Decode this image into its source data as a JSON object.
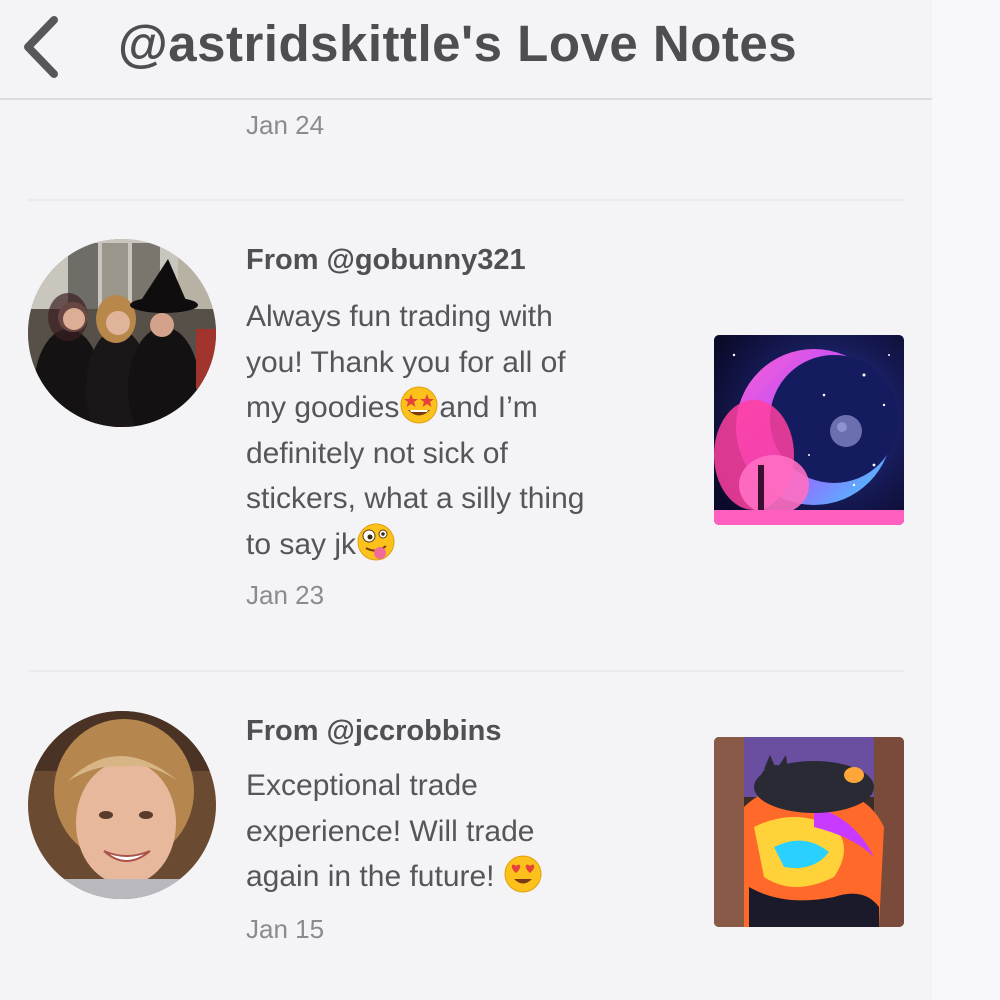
{
  "header": {
    "back_icon": "chevron-left-icon",
    "title": "@astridskittle's Love Notes"
  },
  "notes": [
    {
      "date": "Jan 24"
    },
    {
      "sender": "From @gobunny321",
      "message_lines": [
        "Always fun trading with",
        "you! Thank you for all of",
        "my goodies",
        "and I’m",
        "definitely not sick of",
        "stickers, what a silly thing",
        "to say jk"
      ],
      "emojis": [
        "star-struck-emoji",
        "zany-face-emoji"
      ],
      "date": "Jan 23",
      "photo": "moon-artwork-photo",
      "avatar": "three-women-costume-avatar"
    },
    {
      "sender": "From @jccrobbins",
      "message_lines": [
        "Exceptional trade",
        "experience! Will trade",
        "again in the future!"
      ],
      "emojis": [
        "heart-eyes-emoji"
      ],
      "date": "Jan 15",
      "photo": "cat-on-tie-dye-photo",
      "avatar": "smiling-woman-avatar"
    }
  ],
  "colors": {
    "background": "#f4f4f7",
    "title_text": "#4d4d52",
    "body_text": "#55555a",
    "date_text": "#8a8a90",
    "divider": "#ebebee"
  }
}
